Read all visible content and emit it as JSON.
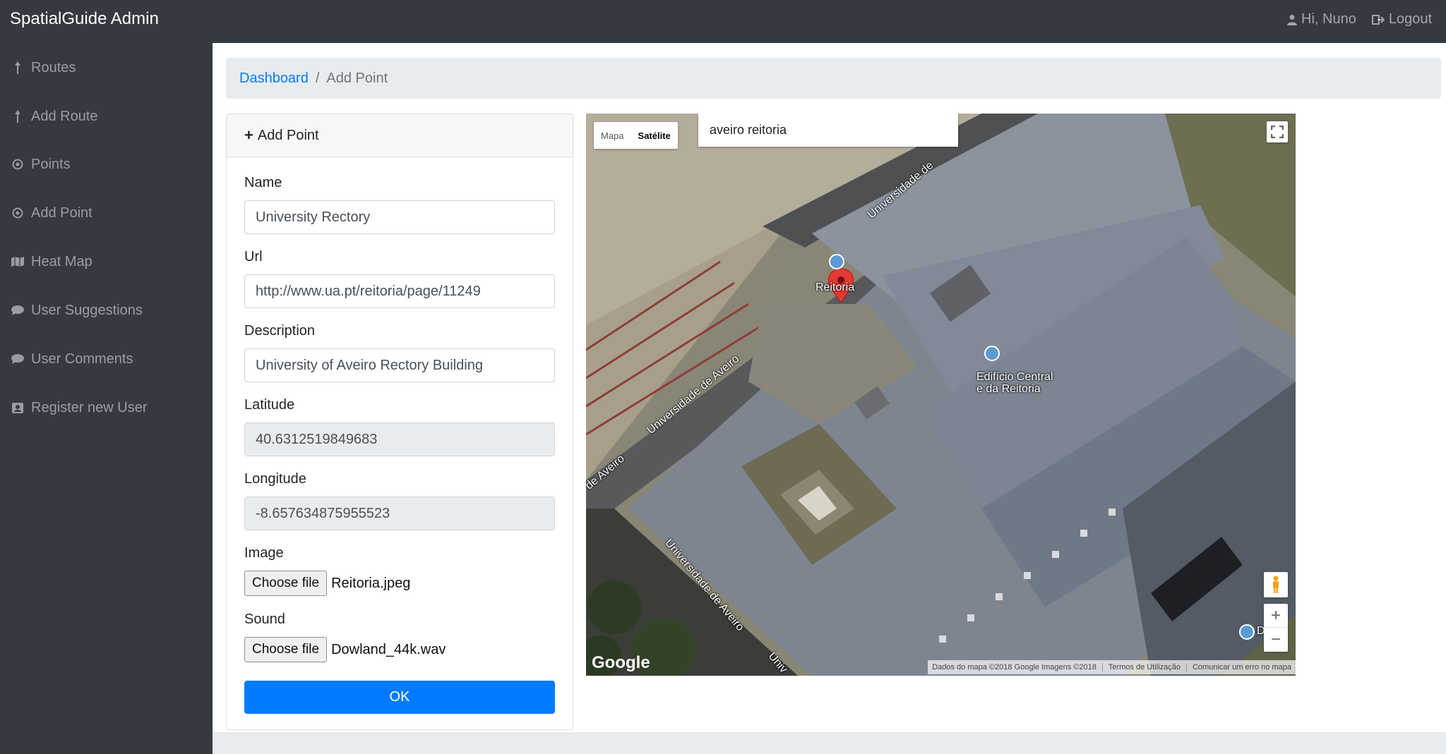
{
  "navbar": {
    "brand": "SpatialGuide Admin",
    "user_greeting": "Hi, Nuno",
    "logout_label": "Logout"
  },
  "sidebar": {
    "items": [
      {
        "label": "Routes",
        "icon": "arrow-up-icon"
      },
      {
        "label": "Add Route",
        "icon": "arrow-up-icon"
      },
      {
        "label": "Points",
        "icon": "dot-circle-icon"
      },
      {
        "label": "Add Point",
        "icon": "dot-circle-icon"
      },
      {
        "label": "Heat Map",
        "icon": "map-icon"
      },
      {
        "label": "User Suggestions",
        "icon": "comment-icon"
      },
      {
        "label": "User Comments",
        "icon": "comment-icon"
      },
      {
        "label": "Register new User",
        "icon": "user-card-icon"
      }
    ]
  },
  "breadcrumb": {
    "home": "Dashboard",
    "separator": "/",
    "current": "Add Point"
  },
  "form": {
    "title": "Add Point",
    "name_label": "Name",
    "name_value": "University Rectory",
    "url_label": "Url",
    "url_value": "http://www.ua.pt/reitoria/page/11249",
    "description_label": "Description",
    "description_value": "University of Aveiro Rectory Building",
    "latitude_label": "Latitude",
    "latitude_value": "40.6312519849683",
    "longitude_label": "Longitude",
    "longitude_value": "-8.657634875955523",
    "image_label": "Image",
    "image_button": "Choose file",
    "image_file": "Reitoria.jpeg",
    "sound_label": "Sound",
    "sound_button": "Choose file",
    "sound_file": "Dowland_44k.wav",
    "submit_label": "OK"
  },
  "map": {
    "type_map": "Mapa",
    "type_satellite": "Satélite",
    "search_value": "aveiro reitoria",
    "labels": {
      "street_top": "Universidade de",
      "street_mid": "Universidade de Aveiro",
      "street_left": "de Aveiro",
      "street_bottom": "Universidade de Aveiro",
      "street_bottom2": "Univ",
      "marker_label": "Reitoria",
      "poi_line1": "Edifício Central",
      "poi_line2": "e da Reitoria",
      "poi_right": "De"
    },
    "google": "Google",
    "attribution": {
      "data": "Dados do mapa ©2018 Google Imagens ©2018",
      "terms": "Termos de Utilização",
      "report": "Comunicar um erro no mapa"
    },
    "zoom_in": "+",
    "zoom_out": "−"
  },
  "colors": {
    "navbar": "#343a40",
    "primary": "#007bff",
    "breadcrumb_bg": "#e9ecef",
    "marker": "#e53935"
  }
}
